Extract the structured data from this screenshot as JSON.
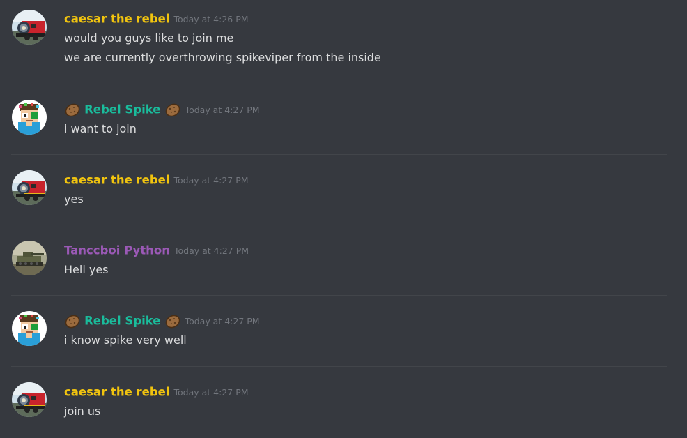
{
  "colors": {
    "background": "#36393f",
    "text": "#dcddde",
    "timestamp": "#72767d",
    "divider": "#42454a",
    "caesar": "#f1c40f",
    "rebel": "#1abc9c",
    "tanccboi": "#9b59b6"
  },
  "messages": [
    {
      "username": "caesar the rebel",
      "timestamp": "Today at 4:26 PM",
      "avatar_icon": "train-avatar-icon",
      "lines": [
        "would you guys like to join me",
        "we are currently overthrowing spikeviper from the inside"
      ]
    },
    {
      "username": "Rebel Spike",
      "timestamp": "Today at 4:27 PM",
      "avatar_icon": "pixel-character-avatar-icon",
      "decoration_icon": "potato-emoji-icon",
      "lines": [
        "i want to join"
      ]
    },
    {
      "username": "caesar the rebel",
      "timestamp": "Today at 4:27 PM",
      "avatar_icon": "train-avatar-icon",
      "lines": [
        "yes"
      ]
    },
    {
      "username": "Tanccboi Python",
      "timestamp": "Today at 4:27 PM",
      "avatar_icon": "tank-avatar-icon",
      "lines": [
        "Hell yes"
      ]
    },
    {
      "username": "Rebel Spike",
      "timestamp": "Today at 4:27 PM",
      "avatar_icon": "pixel-character-avatar-icon",
      "decoration_icon": "potato-emoji-icon",
      "lines": [
        "i know spike very well"
      ]
    },
    {
      "username": "caesar the rebel",
      "timestamp": "Today at 4:27 PM",
      "avatar_icon": "train-avatar-icon",
      "lines": [
        "join us"
      ]
    }
  ]
}
